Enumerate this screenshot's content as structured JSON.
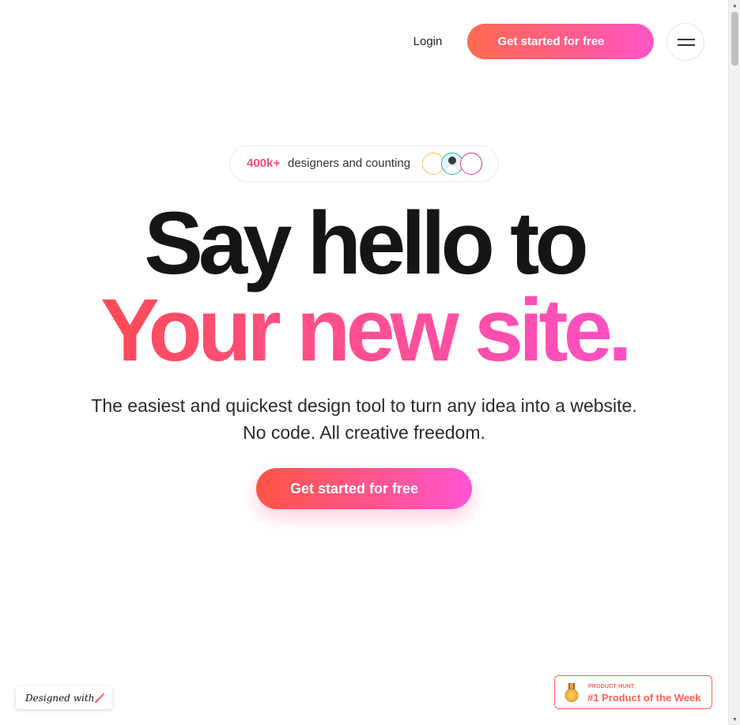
{
  "header": {
    "login_label": "Login",
    "cta_label": "Get started for free",
    "menu_icon": "hamburger-menu-icon"
  },
  "social_proof": {
    "count": "400k+",
    "text": "designers and counting",
    "avatars": [
      "avatar-yellow-ring",
      "avatar-person",
      "avatar-magenta-ring"
    ]
  },
  "hero": {
    "headline_line1": "Say hello to",
    "headline_line2": "Your new site.",
    "subtitle_line1": "The easiest and quickest design tool to turn any idea into a website.",
    "subtitle_line2": "No code. All creative freedom.",
    "cta_label": "Get started for free"
  },
  "designed_with_badge": {
    "text": "Designed with",
    "logo_icon": "pen-stroke-icon"
  },
  "product_hunt_badge": {
    "label": "PRODUCT HUNT",
    "title": "#1 Product of the Week",
    "icon": "medal-icon"
  },
  "colors": {
    "accent_start": "#ff5545",
    "accent_mid": "#ff5590",
    "accent_end": "#ff55d2",
    "product_hunt": "#ff6154",
    "headline_dark": "#151515"
  }
}
